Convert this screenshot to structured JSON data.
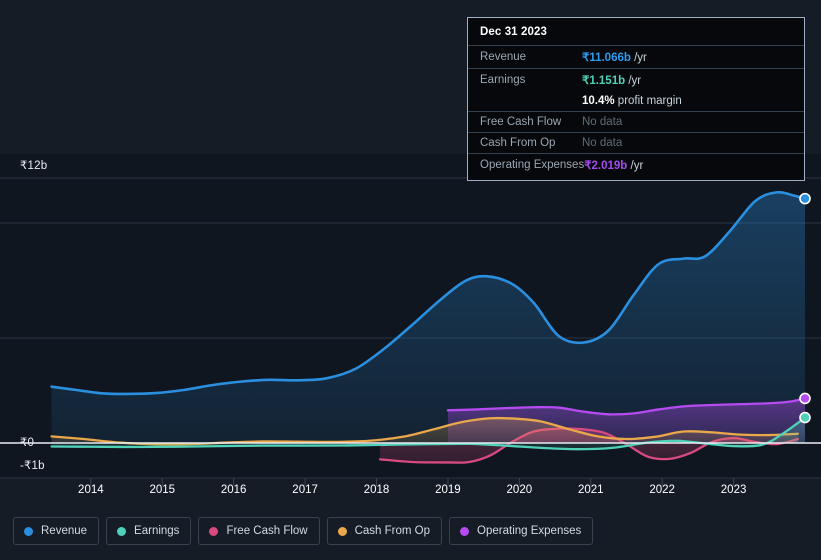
{
  "chart_data": {
    "type": "area",
    "title": "",
    "xlabel": "",
    "ylabel": "",
    "currency": "₹",
    "ylim": [
      -1,
      12
    ],
    "y_ticks": [
      {
        "value": 12,
        "label": "₹12b"
      },
      {
        "value": 0,
        "label": "₹0"
      },
      {
        "value": -1,
        "label": "-₹1b"
      }
    ],
    "x_ticks": [
      "2014",
      "2015",
      "2016",
      "2017",
      "2018",
      "2019",
      "2020",
      "2021",
      "2022",
      "2023"
    ],
    "x_range": [
      2013.4,
      2024.0
    ],
    "grid": true,
    "legend_position": "bottom",
    "series": [
      {
        "name": "Revenue",
        "color": "#2b8fe0",
        "points": [
          [
            2013.45,
            2.55
          ],
          [
            2013.8,
            2.4
          ],
          [
            2014.15,
            2.25
          ],
          [
            2014.5,
            2.22
          ],
          [
            2014.9,
            2.26
          ],
          [
            2015.3,
            2.4
          ],
          [
            2015.7,
            2.62
          ],
          [
            2016.1,
            2.78
          ],
          [
            2016.5,
            2.86
          ],
          [
            2016.9,
            2.84
          ],
          [
            2017.3,
            2.93
          ],
          [
            2017.7,
            3.35
          ],
          [
            2018.1,
            4.25
          ],
          [
            2018.5,
            5.35
          ],
          [
            2018.9,
            6.5
          ],
          [
            2019.25,
            7.35
          ],
          [
            2019.55,
            7.55
          ],
          [
            2019.9,
            7.2
          ],
          [
            2020.2,
            6.35
          ],
          [
            2020.55,
            4.85
          ],
          [
            2020.9,
            4.55
          ],
          [
            2021.25,
            5.1
          ],
          [
            2021.6,
            6.7
          ],
          [
            2021.95,
            8.1
          ],
          [
            2022.3,
            8.35
          ],
          [
            2022.6,
            8.45
          ],
          [
            2022.95,
            9.6
          ],
          [
            2023.3,
            10.95
          ],
          [
            2023.6,
            11.35
          ],
          [
            2023.85,
            11.2
          ],
          [
            2024.0,
            11.066
          ]
        ],
        "end_value": 11.066,
        "has_endpoint_marker": true
      },
      {
        "name": "Earnings",
        "color": "#4fd1b8",
        "points": [
          [
            2013.45,
            -0.16
          ],
          [
            2014.0,
            -0.17
          ],
          [
            2014.6,
            -0.18
          ],
          [
            2015.2,
            -0.17
          ],
          [
            2015.8,
            -0.14
          ],
          [
            2016.4,
            -0.12
          ],
          [
            2017.0,
            -0.12
          ],
          [
            2017.6,
            -0.11
          ],
          [
            2018.2,
            -0.08
          ],
          [
            2018.8,
            -0.05
          ],
          [
            2019.3,
            -0.04
          ],
          [
            2019.8,
            -0.12
          ],
          [
            2020.3,
            -0.22
          ],
          [
            2020.8,
            -0.28
          ],
          [
            2021.3,
            -0.22
          ],
          [
            2021.8,
            0.02
          ],
          [
            2022.2,
            0.1
          ],
          [
            2022.6,
            -0.02
          ],
          [
            2023.0,
            -0.14
          ],
          [
            2023.4,
            -0.08
          ],
          [
            2023.7,
            0.45
          ],
          [
            2024.0,
            1.151
          ]
        ],
        "end_value": 1.151,
        "has_endpoint_marker": true
      },
      {
        "name": "Free Cash Flow",
        "color": "#d94a80",
        "starts_at": 2018.05,
        "points": [
          [
            2018.05,
            -0.74
          ],
          [
            2018.5,
            -0.86
          ],
          [
            2019.0,
            -0.88
          ],
          [
            2019.3,
            -0.86
          ],
          [
            2019.6,
            -0.55
          ],
          [
            2019.9,
            0.05
          ],
          [
            2020.2,
            0.52
          ],
          [
            2020.55,
            0.65
          ],
          [
            2020.9,
            0.62
          ],
          [
            2021.2,
            0.45
          ],
          [
            2021.5,
            -0.05
          ],
          [
            2021.8,
            -0.62
          ],
          [
            2022.1,
            -0.72
          ],
          [
            2022.4,
            -0.45
          ],
          [
            2022.7,
            0.05
          ],
          [
            2023.0,
            0.22
          ],
          [
            2023.3,
            0.05
          ],
          [
            2023.6,
            -0.05
          ],
          [
            2023.9,
            0.18
          ]
        ],
        "end_value": null,
        "has_endpoint_marker": false
      },
      {
        "name": "Cash From Op",
        "color": "#e9a84a",
        "points": [
          [
            2013.45,
            0.3
          ],
          [
            2013.9,
            0.18
          ],
          [
            2014.4,
            0.02
          ],
          [
            2014.9,
            -0.06
          ],
          [
            2015.4,
            -0.05
          ],
          [
            2015.9,
            0.02
          ],
          [
            2016.4,
            0.07
          ],
          [
            2016.9,
            0.06
          ],
          [
            2017.4,
            0.05
          ],
          [
            2017.9,
            0.1
          ],
          [
            2018.4,
            0.3
          ],
          [
            2018.8,
            0.62
          ],
          [
            2019.2,
            0.95
          ],
          [
            2019.6,
            1.12
          ],
          [
            2019.95,
            1.1
          ],
          [
            2020.3,
            0.98
          ],
          [
            2020.7,
            0.62
          ],
          [
            2021.1,
            0.3
          ],
          [
            2021.5,
            0.18
          ],
          [
            2021.9,
            0.28
          ],
          [
            2022.3,
            0.52
          ],
          [
            2022.7,
            0.48
          ],
          [
            2023.1,
            0.38
          ],
          [
            2023.5,
            0.36
          ],
          [
            2023.9,
            0.42
          ]
        ],
        "end_value": null,
        "has_endpoint_marker": false
      },
      {
        "name": "Operating Expenses",
        "color": "#b54bf0",
        "starts_at": 2019.0,
        "points": [
          [
            2019.0,
            1.48
          ],
          [
            2019.4,
            1.52
          ],
          [
            2019.8,
            1.58
          ],
          [
            2020.2,
            1.62
          ],
          [
            2020.55,
            1.6
          ],
          [
            2020.9,
            1.42
          ],
          [
            2021.25,
            1.3
          ],
          [
            2021.6,
            1.34
          ],
          [
            2021.95,
            1.52
          ],
          [
            2022.3,
            1.66
          ],
          [
            2022.7,
            1.72
          ],
          [
            2023.1,
            1.76
          ],
          [
            2023.5,
            1.8
          ],
          [
            2023.8,
            1.88
          ],
          [
            2024.0,
            2.019
          ]
        ],
        "end_value": 2.019,
        "has_endpoint_marker": true
      }
    ]
  },
  "tooltip": {
    "date": "Dec 31 2023",
    "rows": [
      {
        "key": "Revenue",
        "value": "₹11.066b",
        "unit": " /yr",
        "color_class": "c-rev",
        "no_data": false
      },
      {
        "key": "Earnings",
        "value": "₹1.151b",
        "unit": " /yr",
        "color_class": "c-earn",
        "no_data": false
      },
      {
        "key": "",
        "value": "10.4%",
        "unit": " profit margin",
        "color_class": "c-white",
        "no_data": false
      },
      {
        "key": "Free Cash Flow",
        "value": "No data",
        "unit": "",
        "color_class": "",
        "no_data": true
      },
      {
        "key": "Cash From Op",
        "value": "No data",
        "unit": "",
        "color_class": "",
        "no_data": true
      },
      {
        "key": "Operating Expenses",
        "value": "₹2.019b",
        "unit": " /yr",
        "color_class": "c-opex",
        "no_data": false
      }
    ]
  },
  "legend": {
    "items": [
      {
        "label": "Revenue",
        "color": "#2b8fe0"
      },
      {
        "label": "Earnings",
        "color": "#4fd1b8"
      },
      {
        "label": "Free Cash Flow",
        "color": "#d94a80"
      },
      {
        "label": "Cash From Op",
        "color": "#e9a84a"
      },
      {
        "label": "Operating Expenses",
        "color": "#b54bf0"
      }
    ]
  }
}
